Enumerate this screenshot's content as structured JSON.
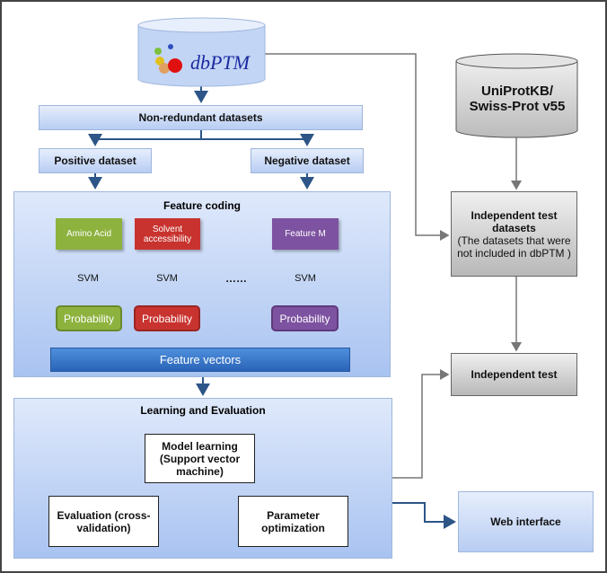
{
  "db": {
    "logo_text": "dbPTM"
  },
  "nonredundant": "Non-redundant  datasets",
  "positive": "Positive dataset",
  "negative": "Negative dataset",
  "feature_coding": {
    "title": "Feature coding",
    "features": [
      {
        "label": "Amino Acid",
        "color": "#8db23e"
      },
      {
        "label": "Solvent accessibility",
        "color": "#c8332f"
      },
      {
        "label": "Feature M",
        "color": "#7d52a0"
      }
    ],
    "svm": "SVM",
    "ellipsis": "……",
    "probability": "Probability",
    "vectors": "Feature vectors"
  },
  "learning": {
    "title": "Learning and Evaluation",
    "model": "Model learning (Support vector machine)",
    "evaluation": "Evaluation (cross-validation)",
    "parameter": "Parameter optimization"
  },
  "uniprot": "UniProtKB/ Swiss-Prot  v55",
  "indep_datasets": {
    "title": "Independent test datasets",
    "note": "(The datasets that were not  included in dbPTM  )"
  },
  "indep_test": "Independent test",
  "web": "Web interface"
}
